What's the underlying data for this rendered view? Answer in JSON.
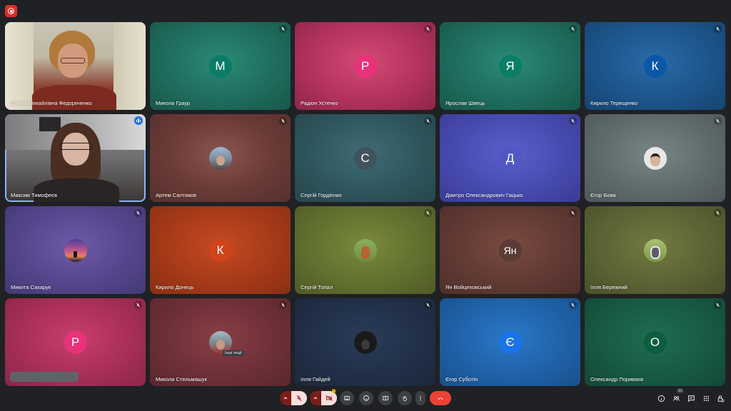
{
  "icons": {
    "recording": "recording-icon",
    "mic_off": "mic-off-icon",
    "cam_off": "camera-off-icon",
    "captions": "captions-icon",
    "emoji": "emoji-icon",
    "present": "present-icon",
    "hand": "raise-hand-icon",
    "more": "more-vert-icon",
    "end_call": "call-end-icon",
    "info": "info-icon",
    "people": "people-icon",
    "chat": "chat-icon",
    "activities": "apps-icon",
    "host": "host-controls-icon"
  },
  "colors": {
    "end_call": "#ea4335",
    "mic_off_bg": "#f9dedc",
    "accent": "#8ab4f8",
    "recording": "#d93025"
  },
  "participants": [
    {
      "name": "Олена Михайлівна Федоряченко"
    },
    {
      "name": "Микола Граур",
      "initial": "М",
      "avatar_color": "#0a7d68"
    },
    {
      "name": "Радіон Устенко",
      "initial": "Р",
      "avatar_color": "#e8327a"
    },
    {
      "name": "Ярослав Швець",
      "initial": "Я",
      "avatar_color": "#0a7d68"
    },
    {
      "name": "Кирило Терещенко",
      "initial": "К",
      "avatar_color": "#0b57a8"
    },
    {
      "name": "Максим Тимофеєв"
    },
    {
      "name": "Артем Салтиков"
    },
    {
      "name": "Сергій Гордієнко",
      "initial": "С",
      "avatar_color": "#41535c"
    },
    {
      "name": "Дмитро Олександрович Гацько",
      "initial": "Д",
      "avatar_color": "#5157c2"
    },
    {
      "name": "Єгор Бова"
    },
    {
      "name": "Микита Сахарук"
    },
    {
      "name": "Кирило Донець",
      "initial": "К",
      "avatar_color": "#d1431b"
    },
    {
      "name": "Сергій Топал"
    },
    {
      "name": "Ян Войцеховський",
      "initial": "Ян",
      "avatar_color": "#5b3b35"
    },
    {
      "name": "Ілля Бережний"
    },
    {
      "name": "",
      "initial": "Р",
      "avatar_color": "#e8327a"
    },
    {
      "name": "Микола Стельмашук",
      "tooltip": "Інші опції"
    },
    {
      "name": "Ілля Гайдей"
    },
    {
      "name": "Єгор Суботін",
      "initial": "Є",
      "avatar_color": "#1a73e8"
    },
    {
      "name": "Олександр Пориваєв",
      "initial": "О",
      "avatar_color": "#0b5e40"
    }
  ],
  "controls": {
    "people_count": "21",
    "camera_badge": "!"
  }
}
